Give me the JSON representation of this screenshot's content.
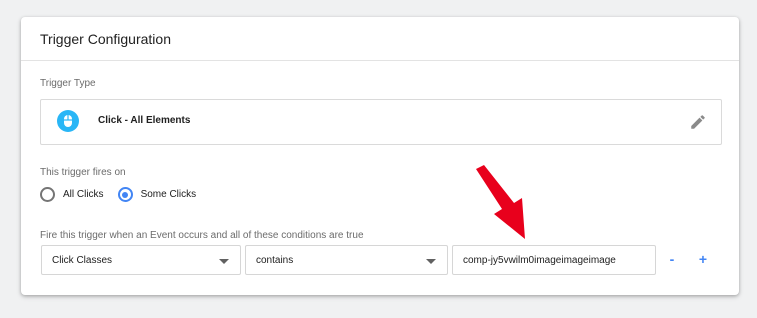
{
  "card": {
    "title": "Trigger Configuration"
  },
  "trigger_type": {
    "label": "Trigger Type",
    "name": "Click - All Elements",
    "icon": "mouse-icon",
    "icon_color": "#29b6f6"
  },
  "fires_on": {
    "label": "This trigger fires on",
    "options": [
      {
        "label": "All Clicks",
        "selected": false
      },
      {
        "label": "Some Clicks",
        "selected": true
      }
    ]
  },
  "condition": {
    "label": "Fire this trigger when an Event occurs and all of these conditions are true",
    "variable": "Click Classes",
    "operator": "contains",
    "value": "comp-jy5vwilm0imageimageimage",
    "remove_label": "-",
    "add_label": "+"
  },
  "colors": {
    "accent": "#4285f4",
    "annotation_arrow": "#e8001c"
  }
}
